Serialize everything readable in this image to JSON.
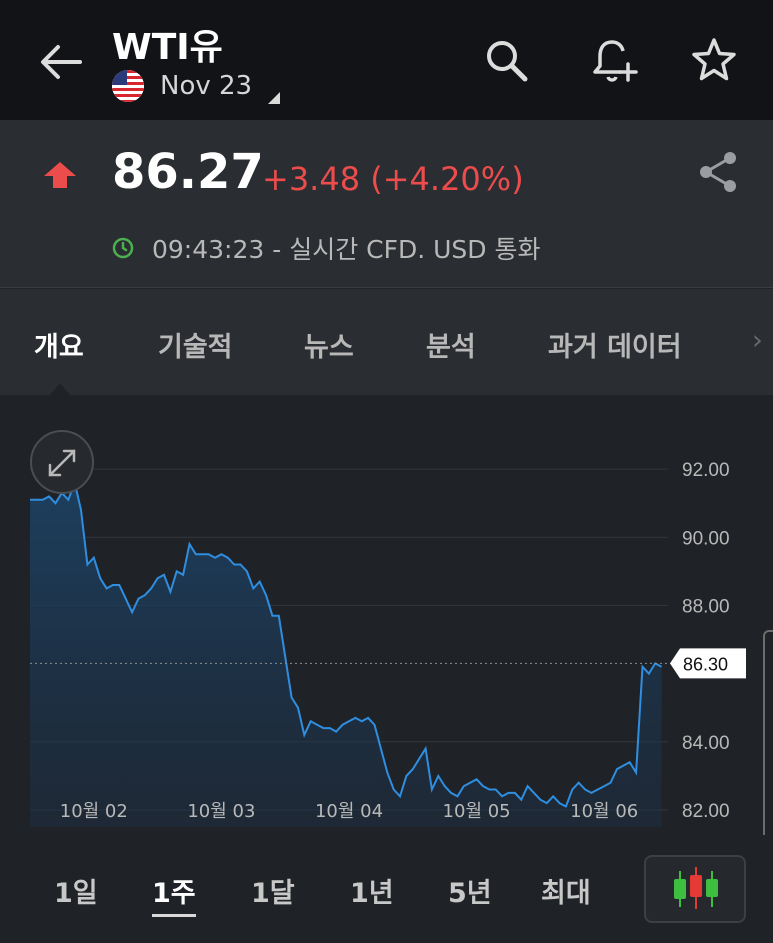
{
  "header": {
    "title": "WTI유",
    "contract": "Nov 23"
  },
  "quote": {
    "price": "86.27",
    "change": "+3.48 (+4.20%)",
    "time": "09:43:23 - 실시간 CFD. USD 통화"
  },
  "tabs": [
    {
      "label": "개요",
      "active": true
    },
    {
      "label": "기술적",
      "active": false
    },
    {
      "label": "뉴스",
      "active": false
    },
    {
      "label": "분석",
      "active": false
    },
    {
      "label": "과거 데이터",
      "active": false
    }
  ],
  "ranges": [
    {
      "label": "1일",
      "active": false
    },
    {
      "label": "1주",
      "active": true
    },
    {
      "label": "1달",
      "active": false
    },
    {
      "label": "1년",
      "active": false
    },
    {
      "label": "5년",
      "active": false
    },
    {
      "label": "최대",
      "active": false
    }
  ],
  "colors": {
    "up": "#ec4c4c",
    "line": "#2f8ee0",
    "fill": "#1c3a5a",
    "clock": "#4caf50"
  },
  "chart_data": {
    "type": "area",
    "y_ticks": [
      "92.00",
      "90.00",
      "88.00",
      "84.00",
      "82.00"
    ],
    "ylim": [
      81.5,
      93.0
    ],
    "last_value_label": "86.30",
    "last_value": 86.3,
    "x_ticks": [
      "10월 02",
      "10월 03",
      "10월 04",
      "10월 05",
      "10월 06"
    ],
    "x_tick_positions": [
      0.5,
      1.5,
      2.5,
      3.5,
      4.5
    ],
    "xlim": [
      0,
      5.0
    ],
    "grid": true,
    "x": [
      0.0,
      0.1,
      0.15,
      0.2,
      0.25,
      0.3,
      0.35,
      0.4,
      0.45,
      0.5,
      0.55,
      0.6,
      0.65,
      0.7,
      0.75,
      0.8,
      0.85,
      0.9,
      0.95,
      1.0,
      1.05,
      1.1,
      1.15,
      1.2,
      1.25,
      1.3,
      1.35,
      1.4,
      1.45,
      1.5,
      1.55,
      1.6,
      1.65,
      1.7,
      1.75,
      1.8,
      1.85,
      1.9,
      1.95,
      2.0,
      2.05,
      2.1,
      2.15,
      2.2,
      2.25,
      2.3,
      2.35,
      2.4,
      2.45,
      2.5,
      2.55,
      2.6,
      2.65,
      2.7,
      2.75,
      2.8,
      2.85,
      2.9,
      2.95,
      3.0,
      3.05,
      3.1,
      3.15,
      3.2,
      3.25,
      3.3,
      3.35,
      3.4,
      3.45,
      3.5,
      3.55,
      3.6,
      3.65,
      3.7,
      3.75,
      3.8,
      3.85,
      3.9,
      3.95,
      4.0,
      4.05,
      4.1,
      4.15,
      4.2,
      4.25,
      4.3,
      4.35,
      4.4,
      4.45,
      4.5,
      4.55,
      4.6,
      4.65,
      4.7,
      4.75,
      4.8,
      4.85,
      4.9,
      4.95
    ],
    "series": [
      {
        "values": [
          91.1,
          91.1,
          91.2,
          91.0,
          91.3,
          91.1,
          91.6,
          90.8,
          89.2,
          89.4,
          88.8,
          88.5,
          88.6,
          88.6,
          88.2,
          87.8,
          88.2,
          88.3,
          88.5,
          88.8,
          88.9,
          88.4,
          89.0,
          88.9,
          89.8,
          89.5,
          89.5,
          89.5,
          89.4,
          89.5,
          89.4,
          89.2,
          89.2,
          89.0,
          88.5,
          88.7,
          88.3,
          87.7,
          87.7,
          86.5,
          85.3,
          85.0,
          84.2,
          84.6,
          84.5,
          84.4,
          84.4,
          84.3,
          84.5,
          84.6,
          84.7,
          84.6,
          84.7,
          84.5,
          83.8,
          83.1,
          82.6,
          82.4,
          83.0,
          83.2,
          83.5,
          83.8,
          82.6,
          83.0,
          82.7,
          82.5,
          82.4,
          82.7,
          82.8,
          82.9,
          82.7,
          82.6,
          82.6,
          82.4,
          82.5,
          82.5,
          82.3,
          82.7,
          82.5,
          82.3,
          82.2,
          82.4,
          82.2,
          82.1,
          82.6,
          82.8,
          82.6,
          82.5,
          82.6,
          82.7,
          82.8,
          83.2,
          83.3,
          83.4,
          83.1,
          86.2,
          86.0,
          86.3,
          86.2
        ]
      }
    ]
  }
}
